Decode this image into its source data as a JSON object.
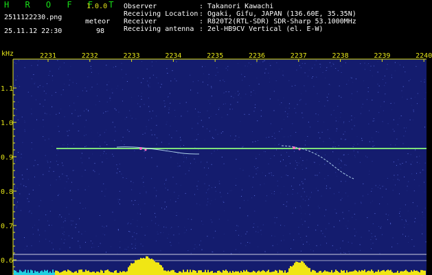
{
  "header": {
    "app_title": "H R O F F T",
    "app_version": "1.0.0",
    "filename": "2511122230.png",
    "datetime": "25.11.12 22:30",
    "meteor_label": "meteor",
    "meteor_count": "98",
    "info": [
      {
        "key": "Observer",
        "value": "Takanori Kawachi"
      },
      {
        "key": "Receiving Location",
        "value": "Ogaki, Gifu, JAPAN (136.60E, 35.35N)"
      },
      {
        "key": "Receiver",
        "value": "R820T2(RTL-SDR) SDR-Sharp 53.1000MHz"
      },
      {
        "key": "Receiving antenna",
        "value": "2el-HB9CV Vertical (el. E-W)"
      }
    ]
  },
  "plot": {
    "y_unit": "kHz",
    "y_ticks": [
      "1.1",
      "1.0",
      "0.9",
      "0.8",
      "0.7",
      "0.6"
    ],
    "time_ticks": [
      "2231",
      "2232",
      "2233",
      "2234",
      "2235",
      "2236",
      "2237",
      "2238",
      "2239",
      "2240"
    ],
    "colors": {
      "background": "#141c6e",
      "axis_text": "#e6e619",
      "signal": "#7ee07a",
      "trace": "#c8f0ff",
      "spectrum": "#f0e614"
    }
  }
}
